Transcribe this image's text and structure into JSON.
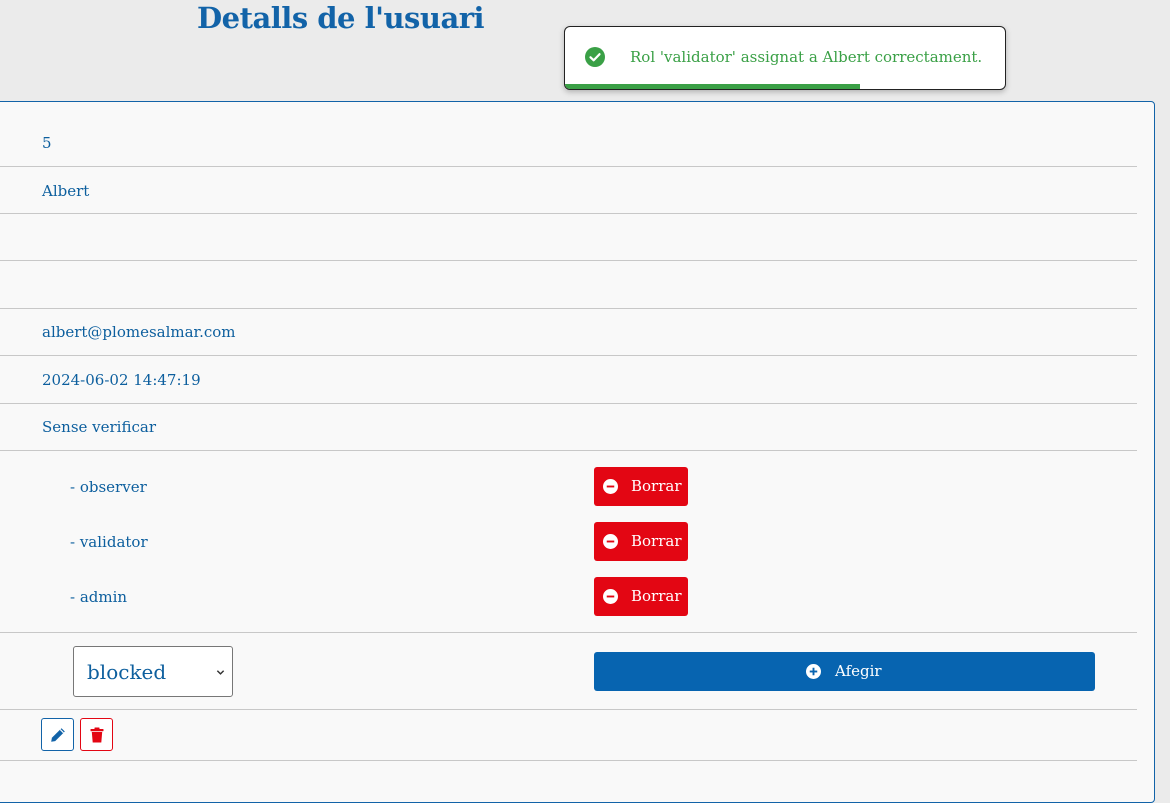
{
  "page": {
    "title": "Detalls de l'usuari"
  },
  "toast": {
    "message": "Rol 'validator' assignat a Albert correctament.",
    "progress": 0.67,
    "icon": "check-circle-icon",
    "color": "#3aa046"
  },
  "user": {
    "id": "5",
    "name": "Albert",
    "field3": "",
    "field4": "",
    "email": "albert@plomesalmar.com",
    "created_at": "2024-06-02 14:47:19",
    "verification": "Sense verificar"
  },
  "roles": [
    {
      "label": "- observer",
      "remove_label": "Borrar"
    },
    {
      "label": "- validator",
      "remove_label": "Borrar"
    },
    {
      "label": "- admin",
      "remove_label": "Borrar"
    }
  ],
  "add_role": {
    "selected": "blocked",
    "button_label": "Afegir"
  },
  "actions": {
    "edit_icon": "pencil-icon",
    "delete_icon": "trash-icon"
  },
  "colors": {
    "primary": "#0764b0",
    "danger": "#e30613",
    "success": "#3aa046"
  }
}
